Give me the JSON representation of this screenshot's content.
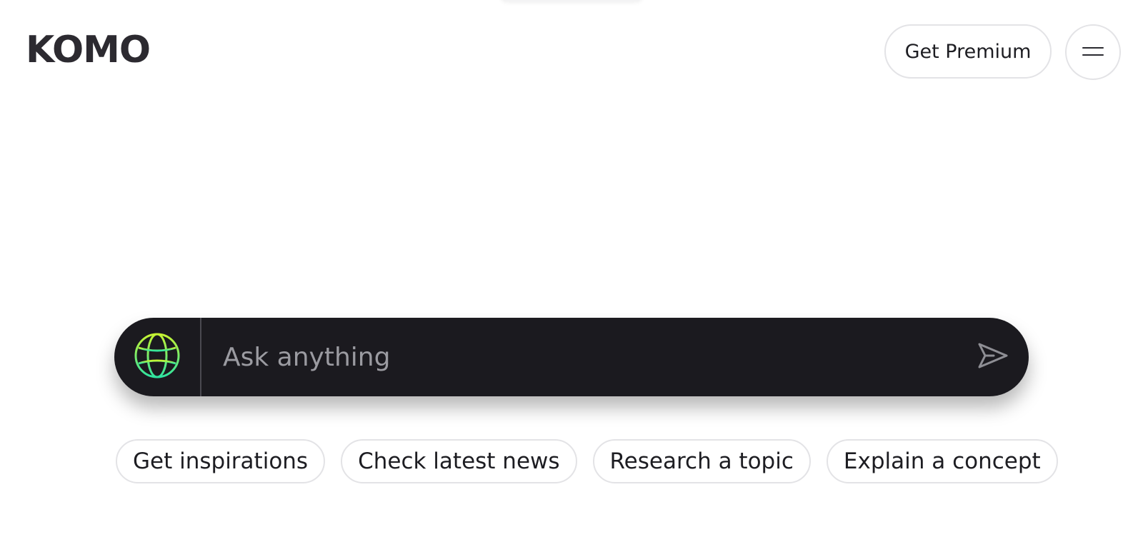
{
  "header": {
    "logo_text": "KOMO",
    "premium_label": "Get Premium",
    "menu_icon": "hamburger-menu-icon"
  },
  "search": {
    "placeholder": "Ask anything",
    "globe_icon": "globe-icon",
    "send_icon": "send-icon"
  },
  "suggestions": [
    {
      "label": "Get inspirations"
    },
    {
      "label": "Check latest news"
    },
    {
      "label": "Research a topic"
    },
    {
      "label": "Explain a concept"
    }
  ],
  "colors": {
    "search_bg": "#1b1a1f",
    "chip_border": "#e3e3e6",
    "globe_gradient_top": "#c6f432",
    "globe_gradient_bottom": "#2ee3a0"
  }
}
